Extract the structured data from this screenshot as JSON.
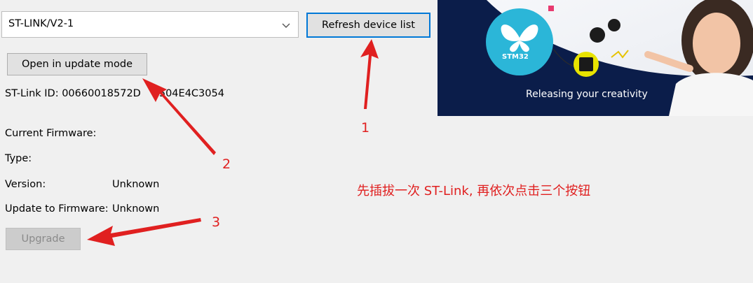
{
  "device_select": {
    "value": "ST-LINK/V2-1"
  },
  "buttons": {
    "refresh": "Refresh device list",
    "open_update": "Open in update mode",
    "upgrade": "Upgrade"
  },
  "info": {
    "stlink_id_label": "ST-Link ID: 00660018572D",
    "stlink_id_tail": "504E4C3054",
    "current_firmware_label": "Current Firmware:",
    "type_label": "Type:",
    "version_label": "Version:",
    "version_value": "Unknown",
    "update_label": "Update to Firmware:",
    "update_value": "Unknown"
  },
  "banner": {
    "logo_text": "STM32",
    "tagline": "Releasing your creativity"
  },
  "annotations": {
    "step1": "1",
    "step2": "2",
    "step3": "3",
    "instruction": "先插拔一次 ST-Link, 再依次点击三个按钮"
  },
  "colors": {
    "annotation_red": "#e02020",
    "focus_blue": "#0078d7",
    "banner_navy": "#0b1d4a",
    "logo_cyan": "#2bb6d8"
  }
}
